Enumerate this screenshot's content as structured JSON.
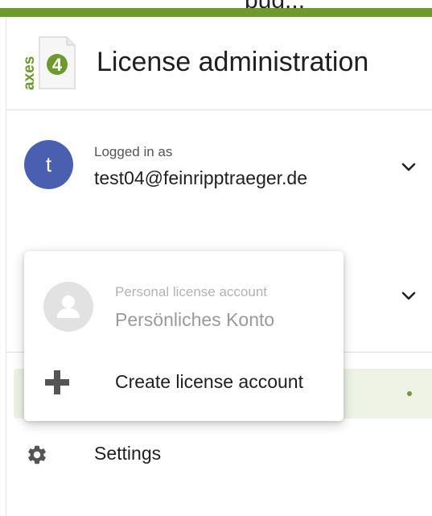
{
  "app": {
    "title": "License administration",
    "logo_text": "axes",
    "logo_mark": "4",
    "partial_top_text": "pug..."
  },
  "colors": {
    "accent": "#6d9a2c",
    "avatar_user": "#4b5fb0"
  },
  "user": {
    "avatar_initial": "t",
    "caption": "Logged in as",
    "email": "test04@feinripptraeger.de",
    "toggle_icon": "chevron-down-icon"
  },
  "account_selector": {
    "toggle_icon": "chevron-down-icon"
  },
  "dropdown": {
    "items": [
      {
        "caption": "Personal license account",
        "name": "Persönliches Konto",
        "icon": "person-icon",
        "disabled": true
      },
      {
        "label": "Create license account",
        "icon": "plus-icon"
      }
    ]
  },
  "nav": {
    "settings_label": "Settings",
    "settings_icon": "gear-icon"
  }
}
